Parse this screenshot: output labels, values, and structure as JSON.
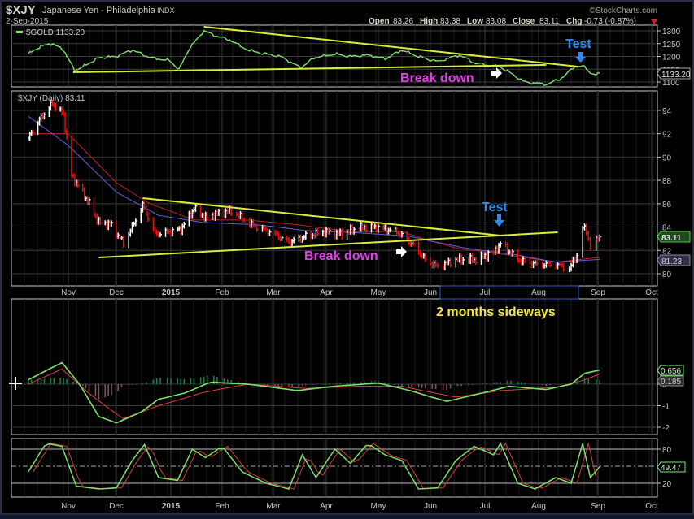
{
  "header": {
    "symbol": "$XJY",
    "name": "Japanese Yen - Philadelphia",
    "exchange": "INDX",
    "date": "2-Sep-2015",
    "brand": "©StockCharts.com",
    "open_label": "Open",
    "open": "83.26",
    "high_label": "High",
    "high": "83.38",
    "low_label": "Low",
    "low": "83.08",
    "close_label": "Close",
    "close": "83.11",
    "chg_label": "Chg",
    "chg": "-0.73 (-0.87%)"
  },
  "colors": {
    "up": "#ffffff",
    "down": "#e01010",
    "gold": "#7ee06a",
    "trend": "#d8ec3c",
    "magenta": "#e040e8",
    "blue": "#2a8cf0",
    "yellow": "#f4e640",
    "ma_red": "#c02020",
    "ma_blue": "#6060e0"
  },
  "chart_data": [
    {
      "type": "line",
      "title": "$GOLD 1133.20",
      "ylim": [
        1080,
        1320
      ],
      "yticks": [
        1100,
        1150,
        1200,
        1250,
        1300
      ],
      "last_label": "1133.20",
      "series": [
        {
          "name": "$GOLD",
          "points": [
            [
              "2014-10-07",
              1210
            ],
            [
              "2014-10-15",
              1240
            ],
            [
              "2014-10-22",
              1250
            ],
            [
              "2014-10-29",
              1225
            ],
            [
              "2014-11-05",
              1145
            ],
            [
              "2014-11-10",
              1160
            ],
            [
              "2014-11-20",
              1195
            ],
            [
              "2014-12-01",
              1200
            ],
            [
              "2014-12-10",
              1225
            ],
            [
              "2014-12-20",
              1195
            ],
            [
              "2014-12-31",
              1185
            ],
            [
              "2015-01-06",
              1150
            ],
            [
              "2015-01-12",
              1230
            ],
            [
              "2015-01-21",
              1300
            ],
            [
              "2015-01-28",
              1280
            ],
            [
              "2015-02-05",
              1265
            ],
            [
              "2015-02-15",
              1225
            ],
            [
              "2015-02-25",
              1210
            ],
            [
              "2015-03-05",
              1200
            ],
            [
              "2015-03-17",
              1155
            ],
            [
              "2015-03-25",
              1195
            ],
            [
              "2015-04-06",
              1210
            ],
            [
              "2015-04-15",
              1200
            ],
            [
              "2015-04-25",
              1205
            ],
            [
              "2015-05-05",
              1190
            ],
            [
              "2015-05-15",
              1225
            ],
            [
              "2015-05-25",
              1200
            ],
            [
              "2015-06-05",
              1180
            ],
            [
              "2015-06-17",
              1205
            ],
            [
              "2015-06-25",
              1175
            ],
            [
              "2015-07-03",
              1165
            ],
            [
              "2015-07-10",
              1160
            ],
            [
              "2015-07-17",
              1130
            ],
            [
              "2015-07-24",
              1100
            ],
            [
              "2015-08-05",
              1090
            ],
            [
              "2015-08-12",
              1110
            ],
            [
              "2015-08-20",
              1160
            ],
            [
              "2015-08-24",
              1165
            ],
            [
              "2015-08-28",
              1135
            ],
            [
              "2015-09-02",
              1133
            ]
          ]
        }
      ]
    },
    {
      "type": "bar",
      "title": "$XJY (Daily) 83.11",
      "ylim": [
        79.2,
        95.8
      ],
      "yticks": [
        80,
        82,
        84,
        86,
        88,
        90,
        92,
        94
      ],
      "last_label": "83.11",
      "ma_label": "81.23",
      "xticks": [
        "Nov",
        "Dec",
        "2015",
        "Feb",
        "Mar",
        "Apr",
        "May",
        "Jun",
        "Jul",
        "Aug",
        "Sep",
        "Oct"
      ],
      "series": [
        {
          "name": "$XJY",
          "points": [
            [
              "2014-10-07",
              91.6
            ],
            [
              "2014-10-14",
              93.2
            ],
            [
              "2014-10-22",
              94.6
            ],
            [
              "2014-10-29",
              93.6
            ],
            [
              "2014-11-03",
              88.4
            ],
            [
              "2014-11-07",
              87.6
            ],
            [
              "2014-11-14",
              86.0
            ],
            [
              "2014-11-20",
              84.4
            ],
            [
              "2014-11-28",
              84.2
            ],
            [
              "2014-12-05",
              82.6
            ],
            [
              "2014-12-10",
              84.0
            ],
            [
              "2014-12-16",
              85.9
            ],
            [
              "2014-12-23",
              83.4
            ],
            [
              "2014-12-31",
              83.6
            ],
            [
              "2015-01-07",
              83.8
            ],
            [
              "2015-01-15",
              85.6
            ],
            [
              "2015-01-22",
              84.8
            ],
            [
              "2015-01-30",
              85.2
            ],
            [
              "2015-02-06",
              85.4
            ],
            [
              "2015-02-17",
              84.2
            ],
            [
              "2015-02-27",
              83.6
            ],
            [
              "2015-03-10",
              82.7
            ],
            [
              "2015-03-20",
              83.2
            ],
            [
              "2015-03-31",
              83.6
            ],
            [
              "2015-04-10",
              83.4
            ],
            [
              "2015-04-20",
              84.0
            ],
            [
              "2015-04-30",
              84.0
            ],
            [
              "2015-05-12",
              83.6
            ],
            [
              "2015-05-22",
              82.4
            ],
            [
              "2015-05-29",
              81.2
            ],
            [
              "2015-06-05",
              80.6
            ],
            [
              "2015-06-15",
              81.2
            ],
            [
              "2015-06-25",
              81.2
            ],
            [
              "2015-07-06",
              81.8
            ],
            [
              "2015-07-10",
              82.6
            ],
            [
              "2015-07-20",
              81.2
            ],
            [
              "2015-07-31",
              80.8
            ],
            [
              "2015-08-10",
              80.8
            ],
            [
              "2015-08-17",
              80.4
            ],
            [
              "2015-08-21",
              81.6
            ],
            [
              "2015-08-24",
              84.0
            ],
            [
              "2015-08-26",
              83.6
            ],
            [
              "2015-08-28",
              82.4
            ],
            [
              "2015-09-02",
              83.1
            ]
          ]
        },
        {
          "name": "MA fast",
          "points": [
            [
              "2014-10-07",
              92.0
            ],
            [
              "2014-11-01",
              92.0
            ],
            [
              "2014-12-01",
              87.8
            ],
            [
              "2014-12-20",
              86.0
            ],
            [
              "2015-01-15",
              84.6
            ],
            [
              "2015-02-15",
              84.6
            ],
            [
              "2015-03-15",
              84.2
            ],
            [
              "2015-04-15",
              83.6
            ],
            [
              "2015-05-15",
              83.6
            ],
            [
              "2015-06-15",
              82.2
            ],
            [
              "2015-07-15",
              81.6
            ],
            [
              "2015-08-10",
              81.0
            ],
            [
              "2015-09-02",
              81.4
            ]
          ]
        },
        {
          "name": "MA slow",
          "points": [
            [
              "2014-10-07",
              93.5
            ],
            [
              "2014-11-01",
              91.0
            ],
            [
              "2014-12-01",
              87.0
            ],
            [
              "2014-12-25",
              85.0
            ],
            [
              "2015-01-20",
              84.4
            ],
            [
              "2015-02-20",
              84.2
            ],
            [
              "2015-03-20",
              83.7
            ],
            [
              "2015-04-20",
              83.5
            ],
            [
              "2015-05-20",
              83.2
            ],
            [
              "2015-06-20",
              82.2
            ],
            [
              "2015-07-20",
              81.6
            ],
            [
              "2015-08-10",
              81.0
            ],
            [
              "2015-09-02",
              81.23
            ]
          ]
        }
      ]
    },
    {
      "type": "line",
      "title": "MACD",
      "ylim": [
        -2.5,
        1.7
      ],
      "yticks": [
        -2,
        -1,
        0
      ],
      "labels": [
        "0.656",
        "0.185"
      ],
      "series": [
        {
          "name": "MACD",
          "points": [
            [
              "2014-10-07",
              0.2
            ],
            [
              "2014-10-20",
              0.7
            ],
            [
              "2014-10-28",
              1.0
            ],
            [
              "2014-11-08",
              0.0
            ],
            [
              "2014-11-20",
              -1.5
            ],
            [
              "2014-12-01",
              -1.8
            ],
            [
              "2014-12-15",
              -1.3
            ],
            [
              "2014-12-25",
              -0.7
            ],
            [
              "2015-01-10",
              -0.4
            ],
            [
              "2015-01-25",
              0.1
            ],
            [
              "2015-02-15",
              0.0
            ],
            [
              "2015-03-15",
              -0.3
            ],
            [
              "2015-04-05",
              -0.1
            ],
            [
              "2015-05-01",
              0.05
            ],
            [
              "2015-05-20",
              -0.3
            ],
            [
              "2015-06-10",
              -0.8
            ],
            [
              "2015-06-30",
              -0.4
            ],
            [
              "2015-07-15",
              -0.1
            ],
            [
              "2015-08-05",
              -0.25
            ],
            [
              "2015-08-18",
              0.0
            ],
            [
              "2015-08-25",
              0.5
            ],
            [
              "2015-09-02",
              0.656
            ]
          ]
        },
        {
          "name": "Signal",
          "points": [
            [
              "2014-10-07",
              0.0
            ],
            [
              "2014-10-28",
              0.7
            ],
            [
              "2014-11-15",
              -0.5
            ],
            [
              "2014-12-05",
              -1.6
            ],
            [
              "2014-12-25",
              -1.0
            ],
            [
              "2015-01-20",
              -0.4
            ],
            [
              "2015-02-15",
              0.0
            ],
            [
              "2015-03-20",
              -0.2
            ],
            [
              "2015-04-20",
              -0.1
            ],
            [
              "2015-05-15",
              -0.1
            ],
            [
              "2015-06-15",
              -0.6
            ],
            [
              "2015-07-10",
              -0.3
            ],
            [
              "2015-08-10",
              -0.15
            ],
            [
              "2015-08-25",
              0.2
            ],
            [
              "2015-09-02",
              0.47
            ]
          ]
        }
      ]
    },
    {
      "type": "line",
      "title": "Stochastic",
      "ylim": [
        0,
        100
      ],
      "yticks": [
        20,
        80
      ],
      "label": "49.47",
      "series": [
        {
          "name": "%K",
          "points": [
            [
              "2014-10-07",
              40
            ],
            [
              "2014-10-18",
              90
            ],
            [
              "2014-10-28",
              85
            ],
            [
              "2014-11-06",
              15
            ],
            [
              "2014-11-20",
              10
            ],
            [
              "2014-12-01",
              12
            ],
            [
              "2014-12-10",
              60
            ],
            [
              "2014-12-17",
              88
            ],
            [
              "2014-12-25",
              30
            ],
            [
              "2015-01-05",
              25
            ],
            [
              "2015-01-14",
              80
            ],
            [
              "2015-01-22",
              65
            ],
            [
              "2015-02-01",
              85
            ],
            [
              "2015-02-12",
              40
            ],
            [
              "2015-02-25",
              20
            ],
            [
              "2015-03-10",
              10
            ],
            [
              "2015-03-18",
              70
            ],
            [
              "2015-03-26",
              30
            ],
            [
              "2015-04-06",
              80
            ],
            [
              "2015-04-15",
              55
            ],
            [
              "2015-04-25",
              90
            ],
            [
              "2015-05-05",
              70
            ],
            [
              "2015-05-15",
              60
            ],
            [
              "2015-05-25",
              10
            ],
            [
              "2015-06-05",
              12
            ],
            [
              "2015-06-15",
              60
            ],
            [
              "2015-06-25",
              85
            ],
            [
              "2015-07-06",
              70
            ],
            [
              "2015-07-10",
              90
            ],
            [
              "2015-07-20",
              20
            ],
            [
              "2015-07-30",
              10
            ],
            [
              "2015-08-10",
              30
            ],
            [
              "2015-08-18",
              20
            ],
            [
              "2015-08-24",
              90
            ],
            [
              "2015-08-28",
              30
            ],
            [
              "2015-09-02",
              49.47
            ]
          ]
        }
      ]
    }
  ],
  "annotations": {
    "gold_breakdown": "Break down",
    "gold_test": "Test",
    "price_breakdown": "Break down",
    "price_test": "Test",
    "sideways": "2 months sideways",
    "gold_trendlines": [
      [
        [
          "2015-01-21",
          1316
        ],
        [
          "2015-08-22",
          1160
        ]
      ],
      [
        [
          "2014-11-04",
          1138
        ],
        [
          "2015-08-05",
          1167
        ]
      ]
    ],
    "price_trendlines": [
      [
        [
          "2014-12-16",
          86.48
        ],
        [
          "2015-07-10",
          83.27
        ]
      ],
      [
        [
          "2014-11-20",
          81.39
        ],
        [
          "2015-08-11",
          83.55
        ]
      ]
    ]
  }
}
